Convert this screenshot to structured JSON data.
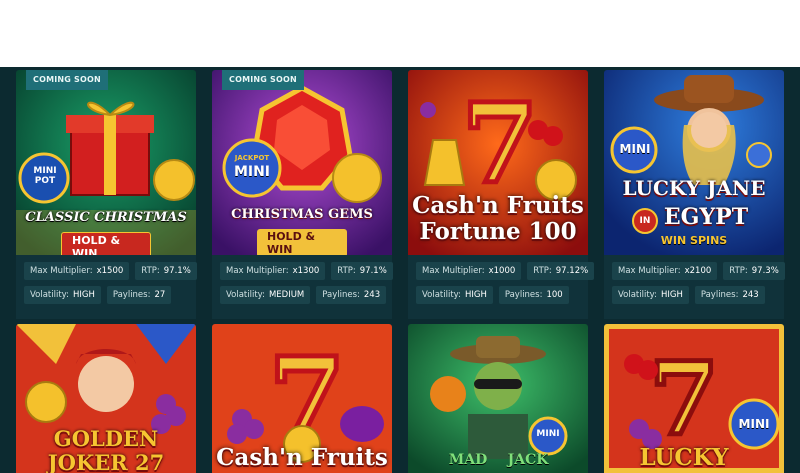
{
  "badge_text": "COMING SOON",
  "labels": {
    "max_multiplier": "Max Multiplier:",
    "rtp": "RTP:",
    "volatility": "Volatility:",
    "paylines": "Paylines:"
  },
  "games_row1": [
    {
      "title_line1": "CLASSIC CHRISTMAS",
      "tag": "HOLD & WIN",
      "jackpot_badge": "MINI POT",
      "coming_soon": true,
      "max_multiplier": "x1500",
      "rtp": "97.1%",
      "volatility": "HIGH",
      "paylines": "27"
    },
    {
      "title_line1": "CHRISTMAS GEMS",
      "tag": "HOLD & WIN",
      "jackpot_badge": "MINI",
      "jackpot_top": "JACKPOT",
      "coming_soon": true,
      "max_multiplier": "x1300",
      "rtp": "97.1%",
      "volatility": "MEDIUM",
      "paylines": "243"
    },
    {
      "title_line1": "Cash'n Fruits",
      "title_line2": "Fortune 100",
      "coming_soon": false,
      "max_multiplier": "x1000",
      "rtp": "97.12%",
      "volatility": "HIGH",
      "paylines": "100"
    },
    {
      "title_line1": "LUCKY JANE",
      "title_in": "IN",
      "title_line2": "EGYPT",
      "tag": "WIN SPINS",
      "jackpot_badge": "MINI",
      "coming_soon": false,
      "max_multiplier": "x2100",
      "rtp": "97.3%",
      "volatility": "HIGH",
      "paylines": "243"
    }
  ],
  "games_row2": [
    {
      "title_line1": "GOLDEN",
      "title_line2": "JOKER 27"
    },
    {
      "title_line1": "Cash'n Fruits"
    },
    {
      "title_line1": "MAD",
      "title_line2": "JACK",
      "jackpot_badge": "MINI"
    },
    {
      "title_line1": "LUCKY",
      "jackpot_badge": "MINI"
    }
  ],
  "colors": {
    "panel_bg": "#0c2a30",
    "info_bg": "#10323a",
    "pill_bg": "#1a434b",
    "badge_bg": "#1f6f78"
  }
}
